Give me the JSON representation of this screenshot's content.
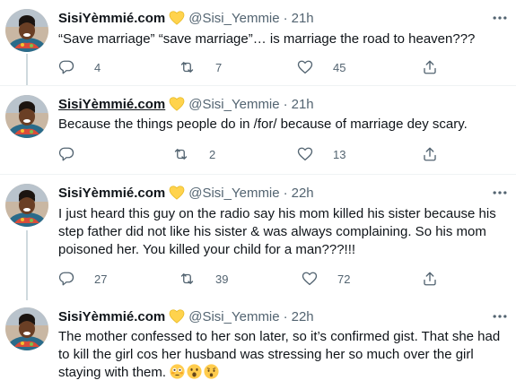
{
  "colors": {
    "secondary_text": "#536471",
    "divider": "#eff3f4",
    "thread_line": "#cfd9de",
    "badge": "#ffd34d"
  },
  "tweets": [
    {
      "name": "SisiYèmmié.com",
      "handle": "@Sisi_Yemmie",
      "dot": "·",
      "time": "21h",
      "text": "“Save marriage” “save marriage”… is marriage the road to heaven???",
      "replies": "4",
      "retweets": "7",
      "likes": "45",
      "icons": {
        "badge": "heart-badge-icon",
        "more": "more-icon",
        "reply": "reply-icon",
        "retweet": "retweet-icon",
        "like": "like-icon",
        "share": "share-icon"
      }
    },
    {
      "name": "SisiYèmmié.com",
      "handle": "@Sisi_Yemmie",
      "dot": "·",
      "time": "21h",
      "text": "Because the things people do in /for/ because of marriage dey scary.",
      "replies": "",
      "retweets": "2",
      "likes": "13"
    },
    {
      "name": "SisiYèmmié.com",
      "handle": "@Sisi_Yemmie",
      "dot": "·",
      "time": "22h",
      "text": "I just heard this guy on the radio say his mom killed his sister because his step father did not like his sister & was always complaining. So his mom poisoned her. You killed your child for a man???!!!",
      "replies": "27",
      "retweets": "39",
      "likes": "72"
    },
    {
      "name": "SisiYèmmié.com",
      "handle": "@Sisi_Yemmie",
      "dot": "·",
      "time": "22h",
      "text": "The mother confessed to her son later, so it’s confirmed gist. That she had to kill the girl cos her husband was stressing her so much over the girl staying with them.",
      "emojis": [
        "flushed-face-emoji",
        "astonished-face-emoji",
        "hushed-face-emoji"
      ]
    }
  ]
}
